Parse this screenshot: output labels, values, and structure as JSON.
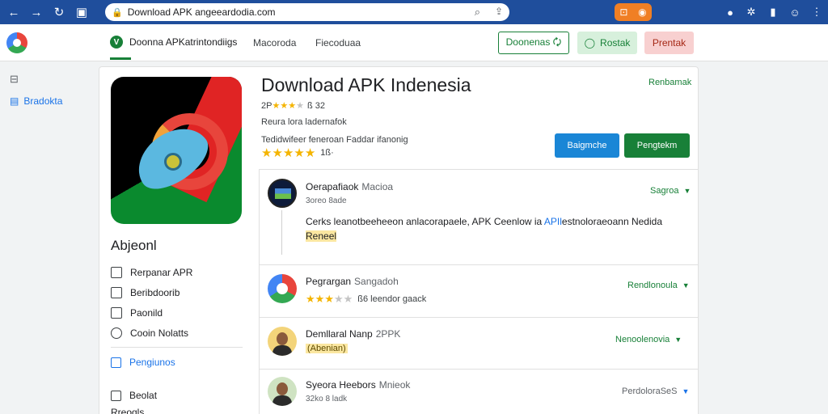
{
  "browser": {
    "url": "Download APK angeeardodia.com",
    "nav": [
      "←",
      "→",
      "↻",
      "▣"
    ]
  },
  "header": {
    "brand_mark": "V",
    "brand": "Doonna APKatrintondiigs",
    "nav": [
      "Macoroda",
      "Fiecoduaa"
    ],
    "btn_outline": "Doonenas 🗘",
    "btn_green": "Rostak",
    "btn_red": "Prentak"
  },
  "sidebar": {
    "active_label": "Bradokta"
  },
  "app": {
    "title": "Download APK Indenesia",
    "rating_line_prefix": "2P",
    "rating_line_suffix": "ß 32",
    "line2": "Reura lora ladernafok",
    "line3": "Tedidwifeer feneroan   Faddar ifanonig",
    "rating_count": "1ß·",
    "top_right_link": "Renbamak",
    "btn_blue": "Baigmche",
    "btn_green": "Pengtekm"
  },
  "left_panel": {
    "title": "Abjeonl",
    "menu": [
      "Rerpanar APR",
      "Beribdoorib",
      "Paonild",
      "Cooin Nolatts"
    ],
    "sub_link": "Pengiunos",
    "bottom": [
      "Beolat",
      "Rreoqls"
    ]
  },
  "list": {
    "rows": [
      {
        "name": "Oerapafiaok",
        "name_muted": "Macioa",
        "sub": "3oreo 8ade",
        "action": "Sagroa",
        "body_before": "Cerks leanotbeeheeon anlacorapaele, APK Ceenlow ia ",
        "body_link": "APIl",
        "body_after": "estnoloraeoann Nedida",
        "body_tag": "Reneel"
      },
      {
        "name": "Pegrargan",
        "name_muted": "Sangadoh",
        "rating_text": "ß6   leendor gaack",
        "action": "Rendlonoula"
      },
      {
        "name": "Demllaral Nanp",
        "name_muted": "2PPK",
        "tag": "(Abenian)",
        "action": "Nenoolenovia"
      },
      {
        "name": "Syeora Heebors",
        "name_muted": "Mnieok",
        "sub": "32ko 8 ladk",
        "action": "PerdoloraSeS"
      }
    ]
  },
  "icons": {
    "back": "arrow-left-icon",
    "forward": "arrow-right-icon",
    "reload": "reload-icon",
    "lock": "lock-icon",
    "search": "search-icon"
  }
}
